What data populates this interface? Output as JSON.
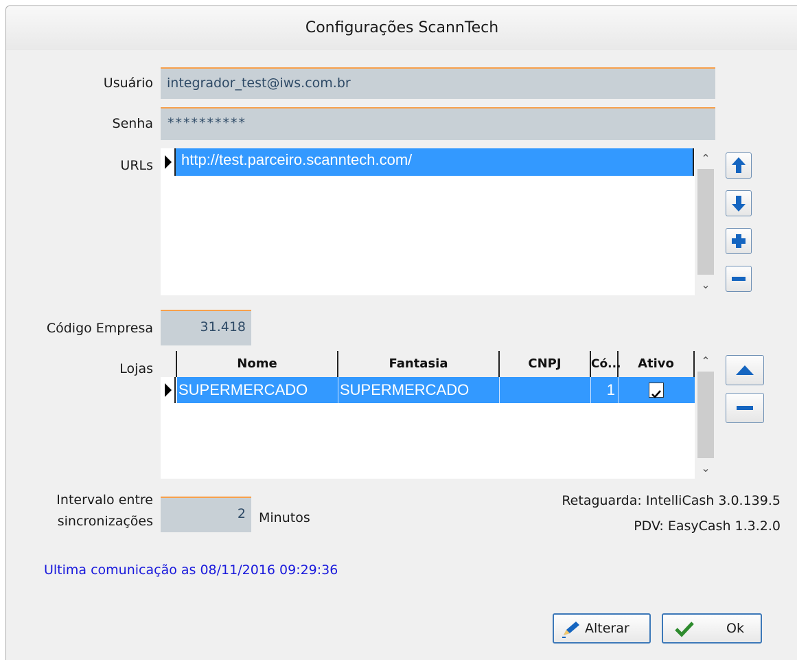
{
  "window": {
    "title": "Configurações ScannTech"
  },
  "form": {
    "usuario_label": "Usuário",
    "usuario_value": "integrador_test@iws.com.br",
    "senha_label": "Senha",
    "senha_value": "**********",
    "urls_label": "URLs",
    "urls": [
      "http://test.parceiro.scanntech.com/"
    ],
    "codigo_empresa_label": "Código Empresa",
    "codigo_empresa_value": "31.418",
    "lojas_label": "Lojas",
    "intervalo_label_line1": "Intervalo entre",
    "intervalo_label_line2": "sincronizações",
    "intervalo_value": "2",
    "intervalo_unit": "Minutos"
  },
  "lojas_table": {
    "columns": [
      "Nome",
      "Fantasia",
      "CNPJ",
      "Có...",
      "Ativo"
    ],
    "rows": [
      {
        "nome": "SUPERMERCADO",
        "fantasia": "SUPERMERCADO",
        "cnpj": "",
        "codigo": "1",
        "ativo": true
      }
    ]
  },
  "info": {
    "retaguarda": "Retaguarda: IntelliCash 3.0.139.5",
    "pdv": "PDV: EasyCash 1.3.2.0",
    "ultima_comunicacao": "Ultima comunicação as 08/11/2016 09:29:36"
  },
  "buttons": {
    "alterar_label": "Alterar",
    "ok_label": "Ok"
  },
  "icons": {
    "url_up": "arrow-up-icon",
    "url_down": "arrow-down-icon",
    "url_add": "plus-icon",
    "url_remove": "minus-icon",
    "loja_up": "triangle-up-icon",
    "loja_remove": "minus-icon",
    "alterar": "pencil-icon",
    "ok": "checkmark-icon",
    "scroll_up": "chevron-up-icon",
    "scroll_down": "chevron-down-icon",
    "row_pointer": "row-indicator-icon"
  },
  "colors": {
    "selection": "#3399ff",
    "field_bg": "#c8d0d6",
    "field_accent": "#f7a04b",
    "status_text": "#1a1adc",
    "button_icon": "#1565c0"
  }
}
